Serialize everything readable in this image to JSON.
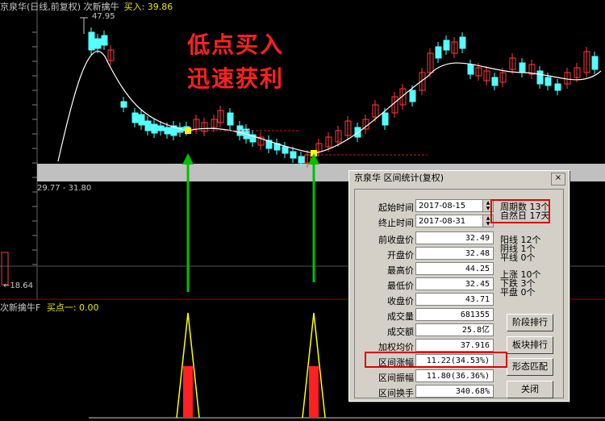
{
  "header": {
    "title": "京泉华(日线,前复权) 次新擒牛",
    "buy_label": "买入: 39.86"
  },
  "price_labels": {
    "high": "47.95",
    "range": "29.77 - 31.80",
    "low": "←18.64"
  },
  "headline": {
    "line1": "低点买入",
    "line2": "迅速获利"
  },
  "indicator": {
    "name": "次新擒牛F",
    "value": "买点一: 0.00"
  },
  "colors": {
    "up": "#ff3c3c",
    "down": "#54ffff",
    "ma": "#ffffff",
    "arrow": "#00c000",
    "signal": "#ffff00",
    "highlight": "#ff2020"
  },
  "dialog": {
    "title": "京泉华 区间统计(复权)",
    "close_label": "×",
    "start_label": "起始时间",
    "start_value": "2017-08-15",
    "end_label": "终止时间",
    "end_value": "2017-08-31",
    "stats": [
      {
        "label": "前收盘价",
        "value": "32.49"
      },
      {
        "label": "开盘价",
        "value": "32.48"
      },
      {
        "label": "最高价",
        "value": "44.25"
      },
      {
        "label": "最低价",
        "value": "32.45"
      },
      {
        "label": "收盘价",
        "value": "43.71"
      },
      {
        "label": "成交量",
        "value": "681355"
      },
      {
        "label": "成交额",
        "value": "25.8亿"
      },
      {
        "label": "加权均价",
        "value": "37.916"
      },
      {
        "label": "区间涨幅",
        "value": "11.22(34.53%)"
      },
      {
        "label": "区间振幅",
        "value": "11.80(36.36%)"
      },
      {
        "label": "区间换手",
        "value": "340.68%"
      }
    ],
    "period_count": "周期数  13个",
    "natural_days": "自然日  17天",
    "yang": "阳线  12个",
    "yin": "阴线  1个",
    "flat_line": "平线  0个",
    "up_days": "上涨  10个",
    "down_days": "下跌  3个",
    "flat_days": "平盘  0个",
    "buttons": {
      "stage_rank": "阶段排行",
      "sector_rank": "板块排行",
      "pattern_match": "形态匹配",
      "close": "关闭"
    }
  }
}
